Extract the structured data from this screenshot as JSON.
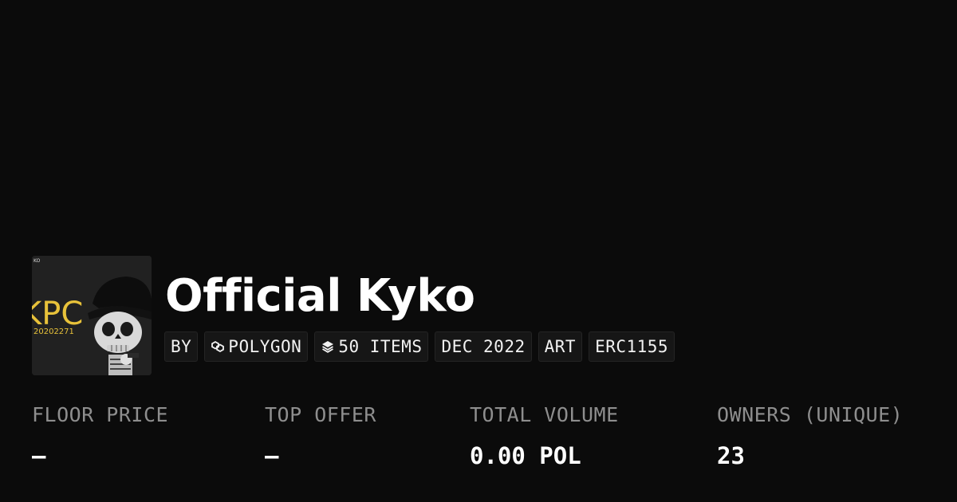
{
  "collection": {
    "title": "Official Kyko",
    "thumbnail": {
      "text_large": "KPC",
      "text_small": "20202271",
      "text_corner": "KO"
    }
  },
  "chips": {
    "by": "BY",
    "chain": "POLYGON",
    "items": "50 ITEMS",
    "date": "DEC 2022",
    "category": "ART",
    "standard": "ERC1155"
  },
  "stats": {
    "floor_price": {
      "label": "FLOOR PRICE",
      "value": "–"
    },
    "top_offer": {
      "label": "TOP OFFER",
      "value": "–"
    },
    "total_volume": {
      "label": "TOTAL VOLUME",
      "value": "0.00 POL"
    },
    "owners": {
      "label": "OWNERS (UNIQUE)",
      "value": "23"
    }
  },
  "colors": {
    "background": "#0b0b0b",
    "text": "#ffffff",
    "muted": "#8e8e8e",
    "thumb_accent": "#e8c23a"
  },
  "icons": {
    "chain": "polygon-icon",
    "items": "layers-icon"
  }
}
